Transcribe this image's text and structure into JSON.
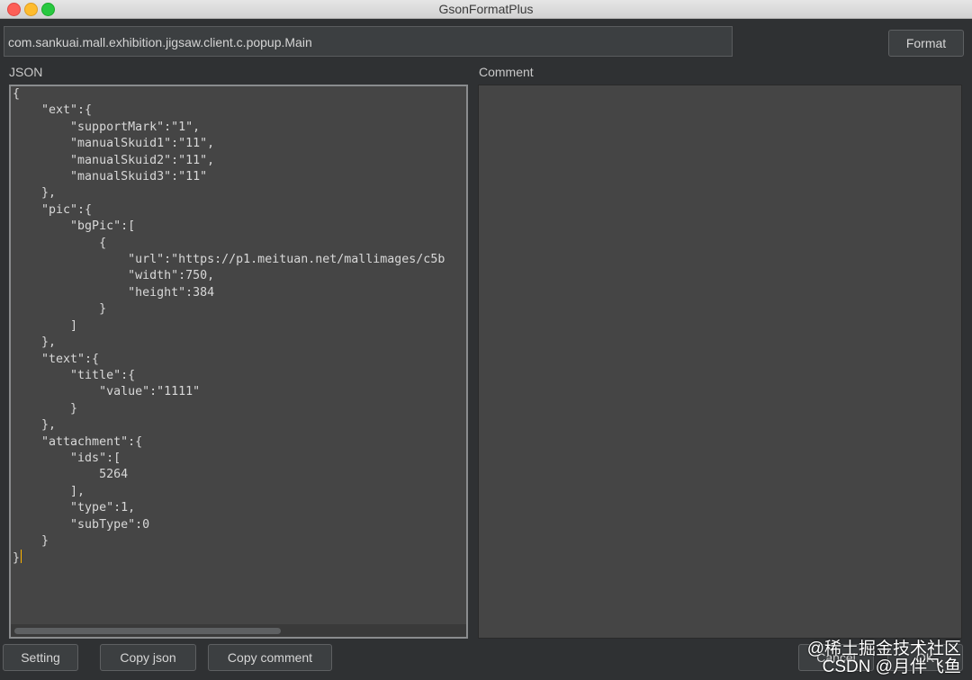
{
  "window": {
    "title": "GsonFormatPlus"
  },
  "class_input": {
    "value": "com.sankuai.mall.exhibition.jigsaw.client.c.popup.Main"
  },
  "buttons": {
    "format": "Format",
    "setting": "Setting",
    "copy_json": "Copy  json",
    "copy_comment": "Copy comment",
    "cancel": "Cancel",
    "ok": "OK"
  },
  "panels": {
    "json_label": "JSON",
    "comment_label": "Comment",
    "json_text": "{\n    \"ext\":{\n        \"supportMark\":\"1\",\n        \"manualSkuid1\":\"11\",\n        \"manualSkuid2\":\"11\",\n        \"manualSkuid3\":\"11\"\n    },\n    \"pic\":{\n        \"bgPic\":[\n            {\n                \"url\":\"https://p1.meituan.net/mallimages/c5b\n                \"width\":750,\n                \"height\":384\n            }\n        ]\n    },\n    \"text\":{\n        \"title\":{\n            \"value\":\"1111\"\n        }\n    },\n    \"attachment\":{\n        \"ids\":[\n            5264\n        ],\n        \"type\":1,\n        \"subType\":0\n    }\n}",
    "comment_text": ""
  },
  "watermark": {
    "line1": "@稀土掘金技术社区",
    "line2": "CSDN @月伴飞鱼"
  }
}
